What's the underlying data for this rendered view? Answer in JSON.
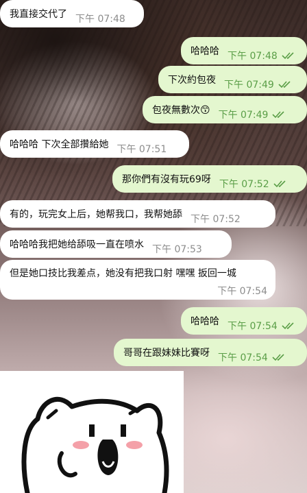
{
  "messages": [
    {
      "text": "我直接交代了",
      "time": "下午 07:48",
      "direction": "in"
    },
    {
      "text": "哈哈哈",
      "time": "下午 07:48",
      "direction": "out",
      "read": true
    },
    {
      "text": "下次約包夜",
      "time": "下午 07:49",
      "direction": "out",
      "read": true
    },
    {
      "text": "包夜無數次😙",
      "time": "下午 07:49",
      "direction": "out",
      "read": true
    },
    {
      "text": "哈哈哈 下次全部攢給她",
      "time": "下午 07:51",
      "direction": "in"
    },
    {
      "text": "那你們有沒有玩69呀",
      "time": "下午 07:52",
      "direction": "out",
      "read": true
    },
    {
      "text": "有的，玩完女上后，她帮我口，我帮她舔",
      "time": "下午 07:52",
      "direction": "in"
    },
    {
      "text": "哈哈哈我把她给舔吸一直在喷水",
      "time": "下午 07:53",
      "direction": "in"
    },
    {
      "text": "但是她口技比我差点，她没有把我口射 嘿嘿 扳回一城",
      "time": "下午 07:54",
      "direction": "in"
    },
    {
      "text": "哈哈哈",
      "time": "下午 07:54",
      "direction": "out",
      "read": true
    },
    {
      "text": "哥哥在跟妹妹比賽呀",
      "time": "下午 07:54",
      "direction": "out",
      "read": true
    }
  ],
  "sticker": {
    "icon": "cartoon-cat-sticker"
  },
  "colors": {
    "incoming": "#ffffff",
    "outgoing": "#e4f7cf",
    "outgoing_time": "#5a9e47",
    "incoming_time": "#8c8c8c"
  }
}
